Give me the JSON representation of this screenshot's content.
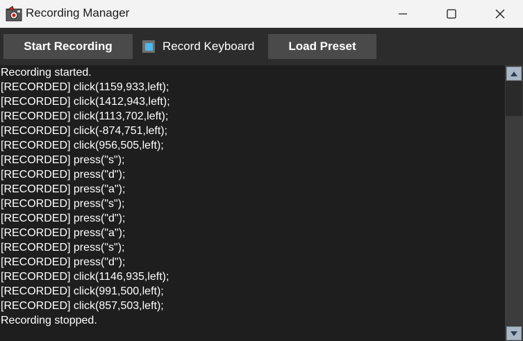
{
  "window": {
    "title": "Recording Manager",
    "app_icon": "recorder-app-icon",
    "controls": {
      "minimize_icon": "minimize-icon",
      "maximize_icon": "maximize-icon",
      "close_icon": "close-icon"
    }
  },
  "toolbar": {
    "start_label": "Start Recording",
    "record_keyboard_label": "Record Keyboard",
    "record_keyboard_checked": true,
    "load_preset_label": "Load Preset"
  },
  "log": {
    "lines": [
      "Recording started.",
      "[RECORDED] click(1159,933,left);",
      "[RECORDED] click(1412,943,left);",
      "[RECORDED] click(1113,702,left);",
      "[RECORDED] click(-874,751,left);",
      "[RECORDED] click(956,505,left);",
      "[RECORDED] press(\"s\");",
      "[RECORDED] press(\"d\");",
      "[RECORDED] press(\"a\");",
      "[RECORDED] press(\"s\");",
      "[RECORDED] press(\"d\");",
      "[RECORDED] press(\"a\");",
      "[RECORDED] press(\"s\");",
      "[RECORDED] press(\"d\");",
      "[RECORDED] click(1146,935,left);",
      "[RECORDED] click(991,500,left);",
      "[RECORDED] click(857,503,left);",
      "Recording stopped."
    ]
  },
  "colors": {
    "accent": "#4fb8ec",
    "background": "#1e1e1e",
    "button": "#4a4a4a",
    "text": "#ffffff"
  }
}
